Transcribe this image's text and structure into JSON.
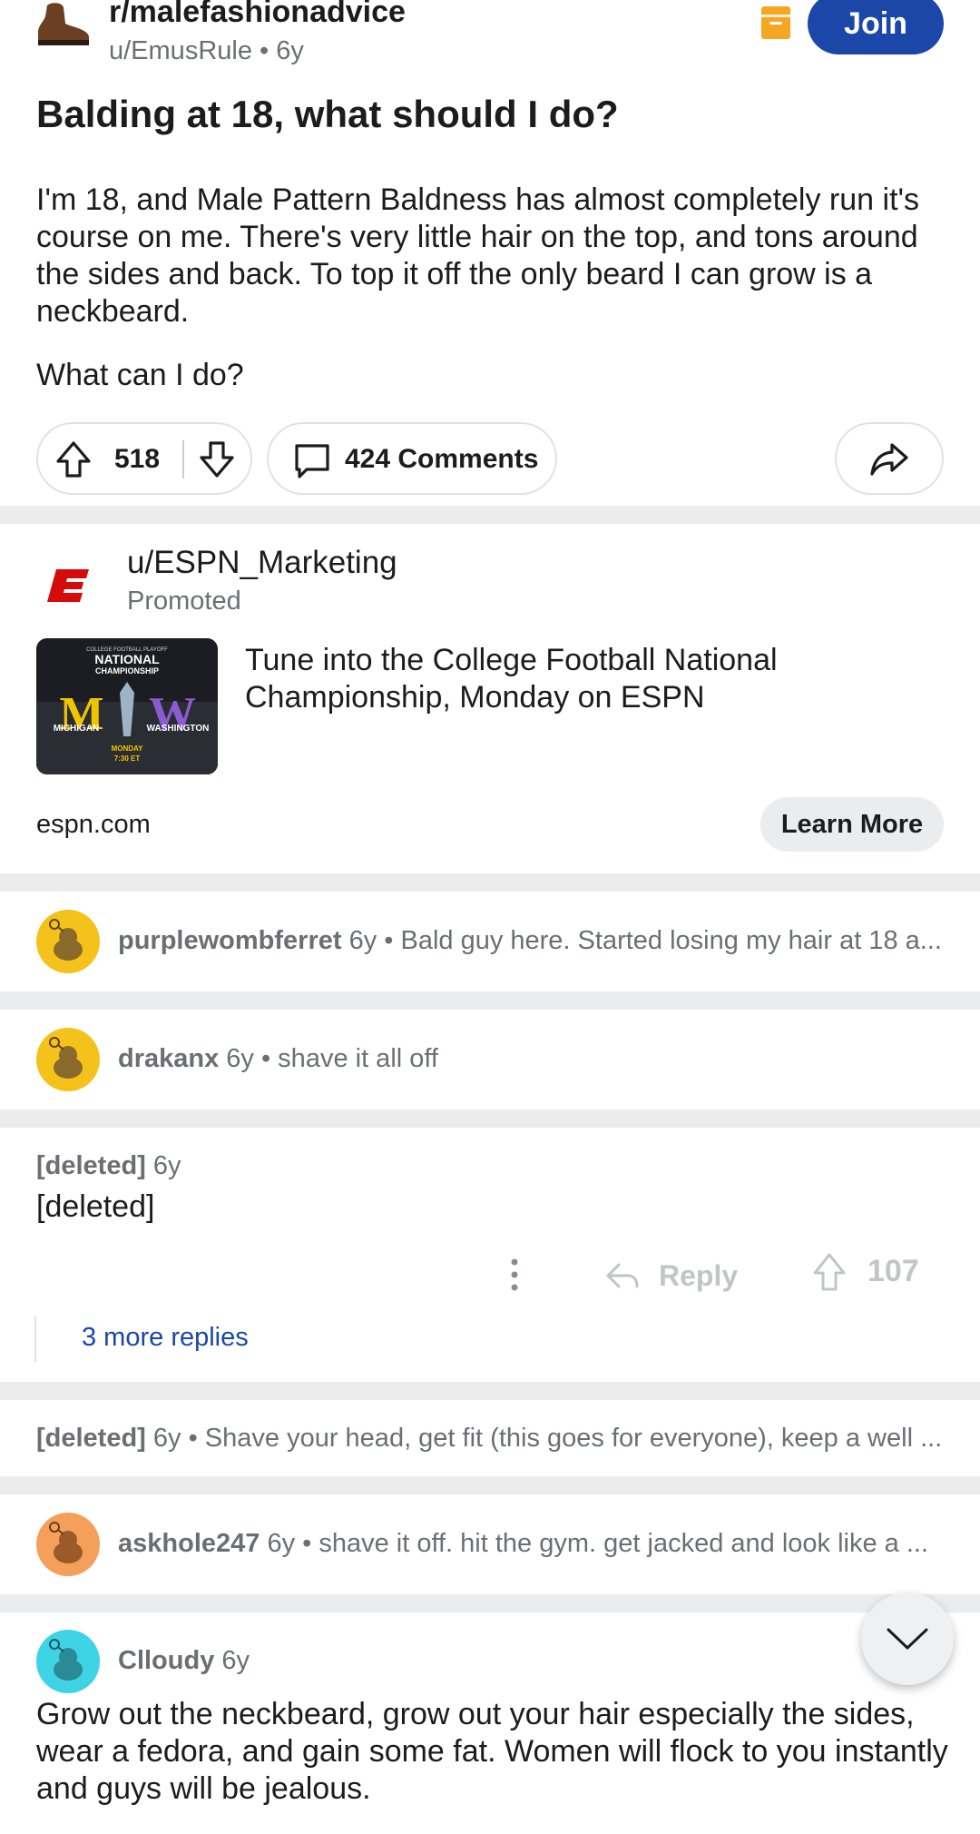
{
  "post": {
    "subreddit": "r/malefashionadvice",
    "author": "u/EmusRule",
    "age": "6y",
    "meta": "u/EmusRule • 6y",
    "join_label": "Join",
    "title": "Balding at 18, what should I do?",
    "body_p1": "I'm 18, and Male Pattern Baldness has almost completely run it's course on me. There's very little hair on the top, and tons around the sides and back. To top it off the only beard I can grow is a neckbeard.",
    "body_p2": "What can I do?",
    "score": "518",
    "comments_label": "424 Comments"
  },
  "ad": {
    "user": "u/ESPN_Marketing",
    "promoted_label": "Promoted",
    "headline": "Tune into the College Football National Championship, Monday on ESPN",
    "domain": "espn.com",
    "cta_label": "Learn More",
    "thumb_line1": "COLLEGE FOOTBALL PLAYOFF",
    "thumb_line2": "NATIONAL",
    "thumb_line3": "CHAMPIONSHIP",
    "thumb_left_team": "MICHIGAN",
    "thumb_right_team": "WASHINGTON",
    "thumb_day": "MONDAY",
    "thumb_time": "7:30 ET",
    "thumb_m": "M",
    "thumb_w": "W"
  },
  "comments": [
    {
      "author": "purplewombferret",
      "meta": " 6y • Bald guy here. Started losing my hair at 18 a..."
    },
    {
      "author": "drakanx",
      "meta": " 6y • shave it all off"
    },
    {
      "author": "[deleted]",
      "age": " 6y",
      "body": "[deleted]",
      "reply_label": "Reply",
      "upvotes": "107",
      "more_replies": "3 more replies"
    },
    {
      "author": "[deleted]",
      "meta": " 6y • Shave your head, get fit (this goes for everyone), keep a well ..."
    },
    {
      "author": "askhole247",
      "meta": " 6y • shave it off. hit the gym. get jacked and look like a ..."
    },
    {
      "author": "Clloudy",
      "age": " 6y",
      "body": "Grow out the neckbeard, grow out your hair especially the sides, wear a fedora, and gain some fat. Women will flock to you instantly and guys will be jealous."
    }
  ],
  "icons": {
    "subreddit": "boot-icon",
    "archive": "archive-icon",
    "upvote": "upvote-arrow-icon",
    "downvote": "downvote-arrow-icon",
    "comment": "comment-bubble-icon",
    "share": "share-arrow-icon",
    "more": "more-vertical-icon",
    "reply": "reply-arrow-icon",
    "scroll": "chevron-down-icon"
  },
  "colors": {
    "join": "#1a47a8",
    "archive": "#f5a623",
    "link": "#1a47a8",
    "espn_red": "#d50a0a"
  }
}
